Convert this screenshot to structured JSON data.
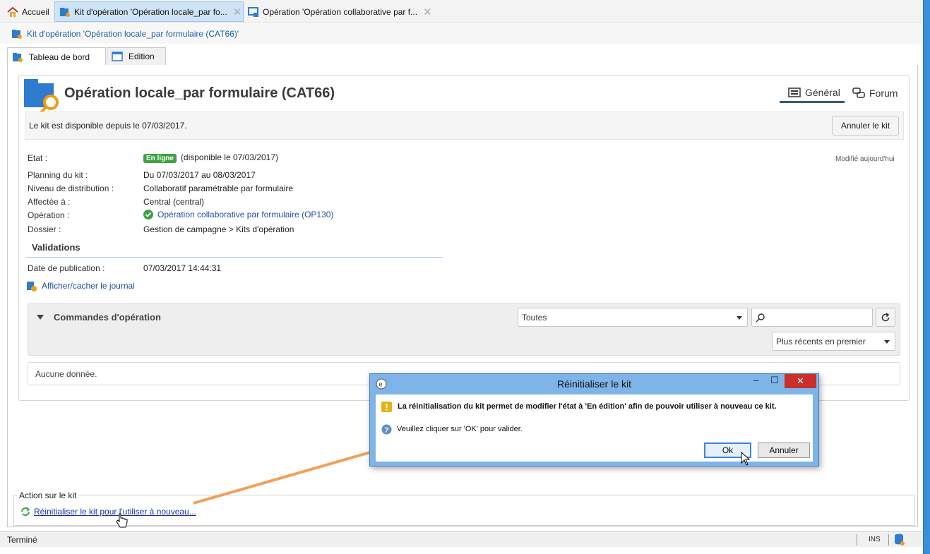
{
  "tabs": [
    {
      "label": "Accueil",
      "icon": "home-icon"
    },
    {
      "label": "Kit d'opération 'Opération locale_par fo...",
      "icon": "kit-folder-icon",
      "active": true
    },
    {
      "label": "Opération 'Opération collaborative par f...",
      "icon": "operation-icon"
    }
  ],
  "breadcrumb": "Kit d'opération 'Opération locale_par formulaire (CAT66)'",
  "subtabs": {
    "dashboard": "Tableau de bord",
    "edition": "Edition"
  },
  "header": {
    "title": "Opération locale_par formulaire (CAT66)",
    "tab_general": "Général",
    "tab_forum": "Forum"
  },
  "infobar": {
    "text": "Le kit est disponible depuis le 07/03/2017.",
    "cancel_button": "Annuler le kit"
  },
  "fields": {
    "etat_label": "Etat :",
    "etat_badge": "En ligne",
    "etat_value": "(disponible le 07/03/2017)",
    "modified": "Modifié aujourd'hui",
    "planning_label": "Planning du kit :",
    "planning_value": "Du 07/03/2017 au 08/03/2017",
    "niveau_label": "Niveau de distribution :",
    "niveau_value": "Collaboratif paramétrable par formulaire",
    "affectee_label": "Affectée à :",
    "affectee_value": "Central (central)",
    "operation_label": "Opération :",
    "operation_value": "Opération collaborative par formulaire (OP130)",
    "dossier_label": "Dossier :",
    "dossier_value": "Gestion de campagne > Kits d'opération"
  },
  "validations": {
    "title": "Validations",
    "date_label": "Date de publication :",
    "date_value": "07/03/2017 14:44:31",
    "journal_link": "Afficher/cacher le journal"
  },
  "commands": {
    "title": "Commandes d'opération",
    "filter_value": "Toutes",
    "search_value": "",
    "sort_value": "Plus récents en premier",
    "empty_text": "Aucune donnée."
  },
  "action": {
    "legend": "Action sur le kit",
    "link": "Réinitialiser le kit pour l'utiliser à nouveau..."
  },
  "status": {
    "text": "Terminé",
    "ins": "INS"
  },
  "dialog": {
    "title": "Réinitialiser le kit",
    "warning": "La réinitialisation du kit permet de modifier l'état à 'En édition' afin de pouvoir utiliser à nouveau ce kit.",
    "question": "Veuillez cliquer sur 'OK' pour valider.",
    "ok": "Ok",
    "cancel": "Annuler",
    "minimize": "–",
    "maximize": "☐",
    "close": "✕"
  },
  "colors": {
    "accent": "#1e5fa8",
    "badge_green": "#3fa244",
    "arrow_orange": "#f0a05a",
    "dialog_frame": "#7eb4e8",
    "close_red": "#c9302c"
  }
}
